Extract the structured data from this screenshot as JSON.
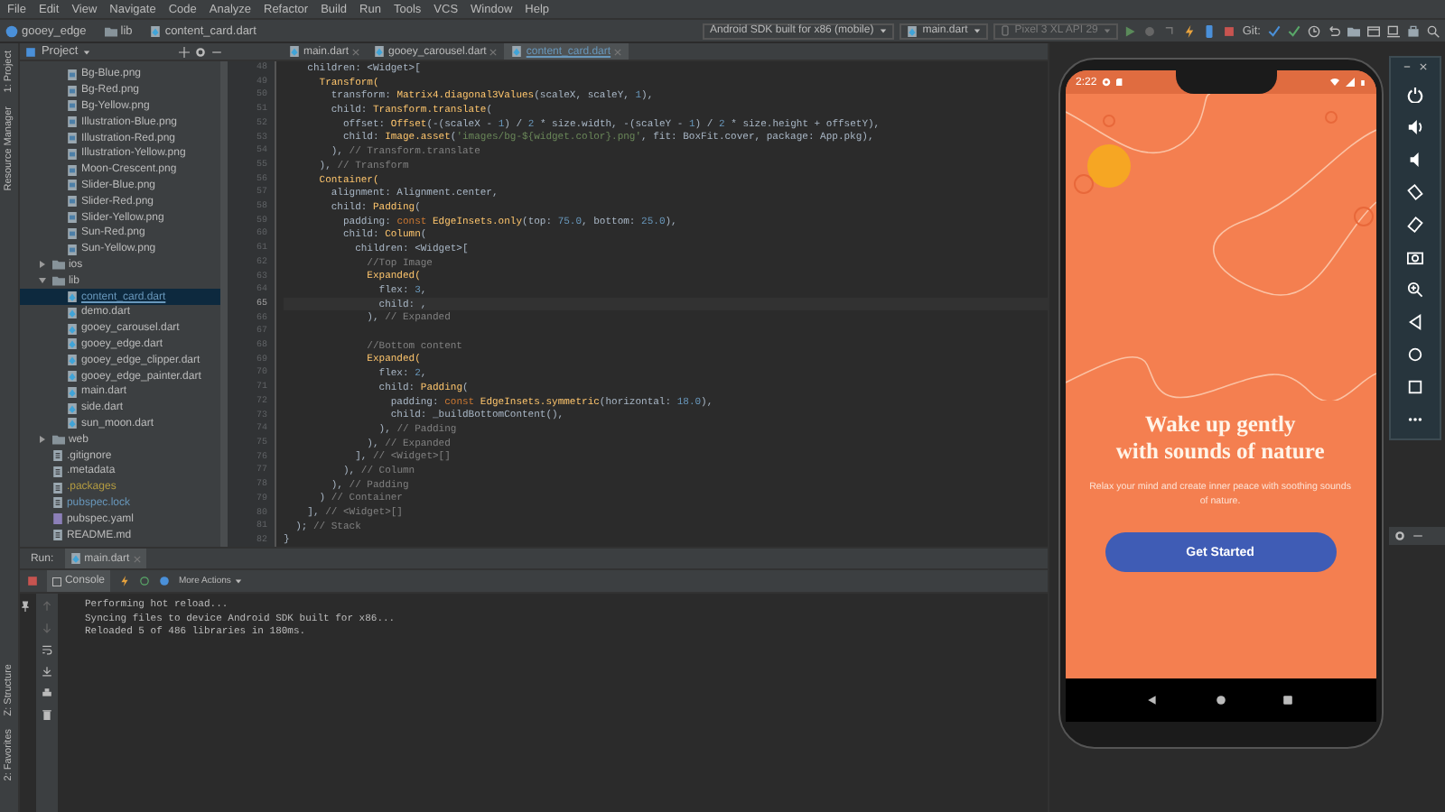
{
  "menu": [
    "File",
    "Edit",
    "View",
    "Navigate",
    "Code",
    "Analyze",
    "Refactor",
    "Build",
    "Run",
    "Tools",
    "VCS",
    "Window",
    "Help"
  ],
  "breadcrumb": [
    {
      "label": "gooey_edge",
      "kind": "project"
    },
    {
      "label": "lib",
      "kind": "folder"
    },
    {
      "label": "content_card.dart",
      "kind": "dart"
    }
  ],
  "toolbar": {
    "device_config": "Android SDK built for x86 (mobile)",
    "run_config": "main.dart",
    "avd": "Pixel 3 XL API 29",
    "git_label": "Git:"
  },
  "side_tabs_top": [
    "1: Project",
    "Resource Manager"
  ],
  "side_tabs_bottom": [
    "Z: Structure",
    "2: Favorites"
  ],
  "project_panel": {
    "title": "Project"
  },
  "editor_tabs": [
    {
      "label": "main.dart",
      "selected": false
    },
    {
      "label": "gooey_carousel.dart",
      "selected": false
    },
    {
      "label": "content_card.dart",
      "selected": true
    }
  ],
  "assets": [
    {
      "label": "Bg-Blue.png",
      "kind": "image",
      "color": "#bbbbbb",
      "selected": false
    },
    {
      "label": "Bg-Red.png",
      "kind": "image",
      "color": "#bbbbbb",
      "selected": false
    },
    {
      "label": "Bg-Yellow.png",
      "kind": "image",
      "color": "#bbbbbb",
      "selected": false
    },
    {
      "label": "Illustration-Blue.png",
      "kind": "image",
      "color": "#bbbbbb",
      "selected": false
    },
    {
      "label": "Illustration-Red.png",
      "kind": "image",
      "color": "#bbbbbb",
      "selected": false
    },
    {
      "label": "Illustration-Yellow.png",
      "kind": "image",
      "color": "#bbbbbb",
      "selected": false
    },
    {
      "label": "Moon-Crescent.png",
      "kind": "image",
      "color": "#bbbbbb",
      "selected": false
    },
    {
      "label": "Slider-Blue.png",
      "kind": "image",
      "color": "#bbbbbb",
      "selected": false
    },
    {
      "label": "Slider-Red.png",
      "kind": "image",
      "color": "#bbbbbb",
      "selected": false
    },
    {
      "label": "Slider-Yellow.png",
      "kind": "image",
      "color": "#bbbbbb",
      "selected": false
    },
    {
      "label": "Sun-Red.png",
      "kind": "image",
      "color": "#bbbbbb",
      "selected": false
    },
    {
      "label": "Sun-Yellow.png",
      "kind": "image",
      "color": "#bbbbbb",
      "selected": false
    }
  ],
  "tree": [
    {
      "label": "ios",
      "kind": "folder",
      "color": "#bbbbbb",
      "selected": false,
      "expanded": false
    },
    {
      "label": "lib",
      "kind": "folder",
      "color": "#bbbbbb",
      "selected": false,
      "expanded": true,
      "children": [
        {
          "label": "content_card.dart",
          "kind": "dart",
          "color": "#6897bb",
          "selected": true
        },
        {
          "label": "demo.dart",
          "kind": "dart",
          "color": "#bbbbbb",
          "selected": false
        },
        {
          "label": "gooey_carousel.dart",
          "kind": "dart",
          "color": "#bbbbbb",
          "selected": false
        },
        {
          "label": "gooey_edge.dart",
          "kind": "dart",
          "color": "#bbbbbb",
          "selected": false
        },
        {
          "label": "gooey_edge_clipper.dart",
          "kind": "dart",
          "color": "#bbbbbb",
          "selected": false
        },
        {
          "label": "gooey_edge_painter.dart",
          "kind": "dart",
          "color": "#bbbbbb",
          "selected": false
        },
        {
          "label": "main.dart",
          "kind": "dart",
          "color": "#bbbbbb",
          "selected": false
        },
        {
          "label": "side.dart",
          "kind": "dart",
          "color": "#bbbbbb",
          "selected": false
        },
        {
          "label": "sun_moon.dart",
          "kind": "dart",
          "color": "#bbbbbb",
          "selected": false
        }
      ]
    },
    {
      "label": "web",
      "kind": "folder",
      "color": "#bbbbbb",
      "selected": false,
      "expanded": false
    },
    {
      "label": ".gitignore",
      "kind": "file",
      "color": "#bbbbbb",
      "selected": false
    },
    {
      "label": ".metadata",
      "kind": "file",
      "color": "#bbbbbb",
      "selected": false
    },
    {
      "label": ".packages",
      "kind": "file",
      "color": "#b39b41",
      "selected": false
    },
    {
      "label": "pubspec.lock",
      "kind": "file",
      "color": "#6897bb",
      "selected": false
    },
    {
      "label": "pubspec.yaml",
      "kind": "yaml",
      "color": "#bbbbbb",
      "selected": false
    },
    {
      "label": "README.md",
      "kind": "file",
      "color": "#bbbbbb",
      "selected": false
    }
  ],
  "code": [
    {
      "number": "48",
      "current": false,
      "kind": "code",
      "segments": [
        {
          "text": "    children: <Widget>[",
          "kind": "plain"
        }
      ]
    },
    {
      "number": "49",
      "current": false,
      "kind": "code",
      "segments": [
        {
          "text": "      Transform(",
          "kind": "cls"
        }
      ]
    },
    {
      "number": "50",
      "current": false,
      "kind": "code",
      "segments": [
        {
          "text": "        transform: ",
          "kind": "plain"
        },
        {
          "text": "Matrix4.diagonal3Values",
          "kind": "cls"
        },
        {
          "text": "(scaleX, scaleY, ",
          "kind": "plain"
        },
        {
          "text": "1",
          "kind": "num"
        },
        {
          "text": "),",
          "kind": "plain"
        }
      ]
    },
    {
      "number": "51",
      "current": false,
      "kind": "code",
      "segments": [
        {
          "text": "        child: ",
          "kind": "plain"
        },
        {
          "text": "Transform.translate",
          "kind": "cls"
        },
        {
          "text": "(",
          "kind": "plain"
        }
      ]
    },
    {
      "number": "52",
      "current": false,
      "kind": "code",
      "segments": [
        {
          "text": "          offset: ",
          "kind": "plain"
        },
        {
          "text": "Offset",
          "kind": "cls"
        },
        {
          "text": "(-(scaleX - ",
          "kind": "plain"
        },
        {
          "text": "1",
          "kind": "num"
        },
        {
          "text": ") / ",
          "kind": "plain"
        },
        {
          "text": "2",
          "kind": "num"
        },
        {
          "text": " * size.width, -(scaleY - ",
          "kind": "plain"
        },
        {
          "text": "1",
          "kind": "num"
        },
        {
          "text": ") / ",
          "kind": "plain"
        },
        {
          "text": "2",
          "kind": "num"
        },
        {
          "text": " * size.height + offsetY),",
          "kind": "plain"
        }
      ]
    },
    {
      "number": "53",
      "current": false,
      "kind": "code",
      "segments": [
        {
          "text": "          child: ",
          "kind": "plain"
        },
        {
          "text": "Image.asset",
          "kind": "cls"
        },
        {
          "text": "(",
          "kind": "plain"
        },
        {
          "text": "'images/bg-${widget.color}.png'",
          "kind": "str"
        },
        {
          "text": ", fit: BoxFit.cover, package: App.pkg),",
          "kind": "plain"
        }
      ]
    },
    {
      "number": "54",
      "current": false,
      "kind": "code",
      "segments": [
        {
          "text": "        ), ",
          "kind": "plain"
        },
        {
          "text": "// Transform.translate",
          "kind": "comment"
        }
      ]
    },
    {
      "number": "55",
      "current": false,
      "kind": "code",
      "segments": [
        {
          "text": "      ), ",
          "kind": "plain"
        },
        {
          "text": "// Transform",
          "kind": "comment"
        }
      ]
    },
    {
      "number": "56",
      "current": false,
      "kind": "code",
      "segments": [
        {
          "text": "      Container(",
          "kind": "cls"
        }
      ]
    },
    {
      "number": "57",
      "current": false,
      "kind": "code",
      "segments": [
        {
          "text": "        alignment: Alignment.center,",
          "kind": "plain"
        }
      ]
    },
    {
      "number": "58",
      "current": false,
      "kind": "code",
      "segments": [
        {
          "text": "        child: ",
          "kind": "plain"
        },
        {
          "text": "Padding",
          "kind": "cls"
        },
        {
          "text": "(",
          "kind": "plain"
        }
      ]
    },
    {
      "number": "59",
      "current": false,
      "kind": "code",
      "segments": [
        {
          "text": "          padding: ",
          "kind": "plain"
        },
        {
          "text": "const ",
          "kind": "kw"
        },
        {
          "text": "EdgeInsets.only",
          "kind": "cls"
        },
        {
          "text": "(top: ",
          "kind": "plain"
        },
        {
          "text": "75.0",
          "kind": "num"
        },
        {
          "text": ", bottom: ",
          "kind": "plain"
        },
        {
          "text": "25.0",
          "kind": "num"
        },
        {
          "text": "),",
          "kind": "plain"
        }
      ]
    },
    {
      "number": "60",
      "current": false,
      "kind": "code",
      "segments": [
        {
          "text": "          child: ",
          "kind": "plain"
        },
        {
          "text": "Column",
          "kind": "cls"
        },
        {
          "text": "(",
          "kind": "plain"
        }
      ]
    },
    {
      "number": "61",
      "current": false,
      "kind": "code",
      "segments": [
        {
          "text": "            children: <Widget>[",
          "kind": "plain"
        }
      ]
    },
    {
      "number": "62",
      "current": false,
      "kind": "code",
      "segments": [
        {
          "text": "              //Top Image",
          "kind": "comment"
        }
      ]
    },
    {
      "number": "63",
      "current": false,
      "kind": "code",
      "segments": [
        {
          "text": "              Expanded(",
          "kind": "cls"
        }
      ]
    },
    {
      "number": "64",
      "current": false,
      "kind": "code",
      "segments": [
        {
          "text": "                flex: ",
          "kind": "plain"
        },
        {
          "text": "3",
          "kind": "num"
        },
        {
          "text": ",",
          "kind": "plain"
        }
      ]
    },
    {
      "number": "65",
      "current": true,
      "kind": "code",
      "segments": [
        {
          "text": "                child: ,",
          "kind": "plain"
        }
      ]
    },
    {
      "number": "66",
      "current": false,
      "kind": "code",
      "segments": [
        {
          "text": "              ), ",
          "kind": "plain"
        },
        {
          "text": "// Expanded",
          "kind": "comment"
        }
      ]
    },
    {
      "number": "67",
      "current": false,
      "kind": "blank"
    },
    {
      "number": "68",
      "current": false,
      "kind": "code",
      "segments": [
        {
          "text": "              //Bottom content",
          "kind": "comment"
        }
      ]
    },
    {
      "number": "69",
      "current": false,
      "kind": "code",
      "segments": [
        {
          "text": "              Expanded(",
          "kind": "cls"
        }
      ]
    },
    {
      "number": "70",
      "current": false,
      "kind": "code",
      "segments": [
        {
          "text": "                flex: ",
          "kind": "plain"
        },
        {
          "text": "2",
          "kind": "num"
        },
        {
          "text": ",",
          "kind": "plain"
        }
      ]
    },
    {
      "number": "71",
      "current": false,
      "kind": "code",
      "segments": [
        {
          "text": "                child: ",
          "kind": "plain"
        },
        {
          "text": "Padding",
          "kind": "cls"
        },
        {
          "text": "(",
          "kind": "plain"
        }
      ]
    },
    {
      "number": "72",
      "current": false,
      "kind": "code",
      "segments": [
        {
          "text": "                  padding: ",
          "kind": "plain"
        },
        {
          "text": "const ",
          "kind": "kw"
        },
        {
          "text": "EdgeInsets.symmetric",
          "kind": "cls"
        },
        {
          "text": "(horizontal: ",
          "kind": "plain"
        },
        {
          "text": "18.0",
          "kind": "num"
        },
        {
          "text": "),",
          "kind": "plain"
        }
      ]
    },
    {
      "number": "73",
      "current": false,
      "kind": "code",
      "segments": [
        {
          "text": "                  child: _buildBottomContent(),",
          "kind": "plain"
        }
      ]
    },
    {
      "number": "74",
      "current": false,
      "kind": "code",
      "segments": [
        {
          "text": "                ), ",
          "kind": "plain"
        },
        {
          "text": "// Padding",
          "kind": "comment"
        }
      ]
    },
    {
      "number": "75",
      "current": false,
      "kind": "code",
      "segments": [
        {
          "text": "              ), ",
          "kind": "plain"
        },
        {
          "text": "// Expanded",
          "kind": "comment"
        }
      ]
    },
    {
      "number": "76",
      "current": false,
      "kind": "code",
      "segments": [
        {
          "text": "            ], ",
          "kind": "plain"
        },
        {
          "text": "// <Widget>[]",
          "kind": "comment"
        }
      ]
    },
    {
      "number": "77",
      "current": false,
      "kind": "code",
      "segments": [
        {
          "text": "          ), ",
          "kind": "plain"
        },
        {
          "text": "// Column",
          "kind": "comment"
        }
      ]
    },
    {
      "number": "78",
      "current": false,
      "kind": "code",
      "segments": [
        {
          "text": "        ), ",
          "kind": "plain"
        },
        {
          "text": "// Padding",
          "kind": "comment"
        }
      ]
    },
    {
      "number": "79",
      "current": false,
      "kind": "code",
      "segments": [
        {
          "text": "      ) ",
          "kind": "plain"
        },
        {
          "text": "// Container",
          "kind": "comment"
        }
      ]
    },
    {
      "number": "80",
      "current": false,
      "kind": "code",
      "segments": [
        {
          "text": "    ], ",
          "kind": "plain"
        },
        {
          "text": "// <Widget>[]",
          "kind": "comment"
        }
      ]
    },
    {
      "number": "81",
      "current": false,
      "kind": "code",
      "segments": [
        {
          "text": "  ); ",
          "kind": "plain"
        },
        {
          "text": "// Stack",
          "kind": "comment"
        }
      ]
    },
    {
      "number": "82",
      "current": false,
      "kind": "code",
      "segments": [
        {
          "text": "}",
          "kind": "plain"
        }
      ]
    }
  ],
  "run_panel": {
    "label": "Run:",
    "tab": "main.dart",
    "console_tab": "Console",
    "more_actions": "More Actions",
    "output": [
      "Performing hot reload...",
      "Syncing files to device Android SDK built for x86...",
      "Reloaded 5 of 486 libraries in 180ms."
    ]
  },
  "phone": {
    "time": "2:22",
    "headline": "Wake up gently\nwith sounds of nature",
    "body": "Relax your mind and create inner peace with soothing sounds of nature.",
    "button": "Get Started"
  }
}
